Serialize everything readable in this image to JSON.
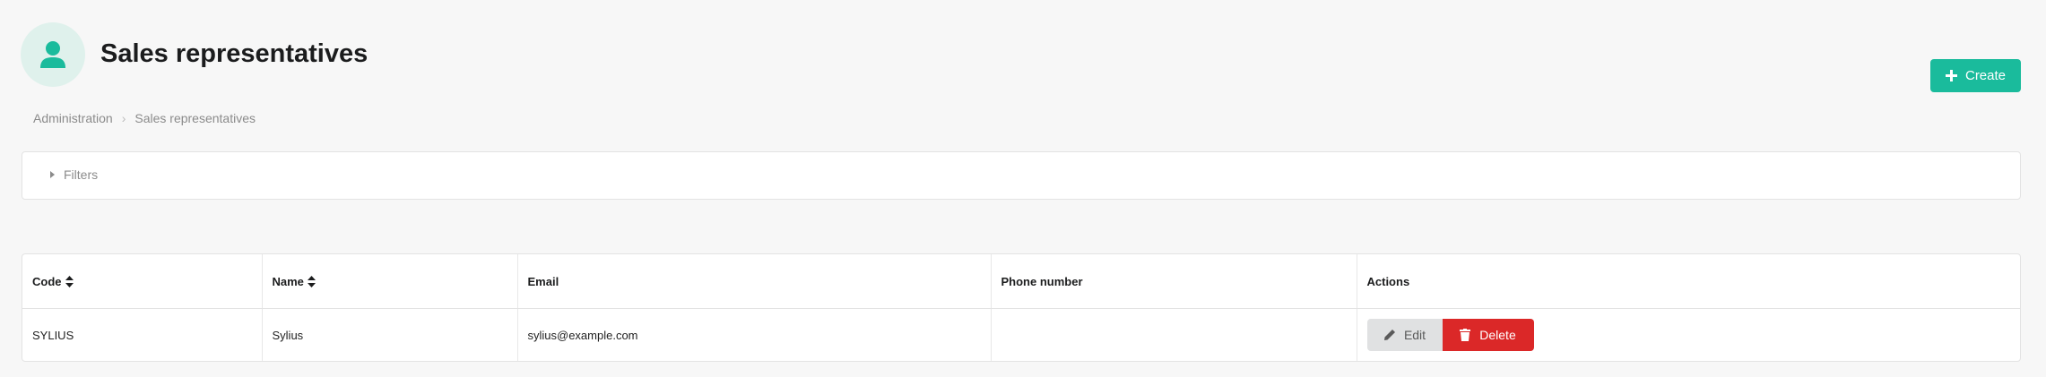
{
  "header": {
    "icon": "user-icon",
    "title": "Sales representatives",
    "create_label": "Create"
  },
  "breadcrumb": {
    "items": [
      "Administration",
      "Sales representatives"
    ]
  },
  "filters": {
    "label": "Filters"
  },
  "table": {
    "columns": [
      "Code",
      "Name",
      "Email",
      "Phone number",
      "Actions"
    ],
    "rows": [
      {
        "code": "SYLIUS",
        "name": "Sylius",
        "email": "sylius@example.com",
        "phone": "",
        "edit_label": "Edit",
        "delete_label": "Delete"
      }
    ]
  },
  "colors": {
    "accent": "#1abb9c",
    "danger": "#db2828",
    "header_icon_bg": "#dff1ec"
  }
}
